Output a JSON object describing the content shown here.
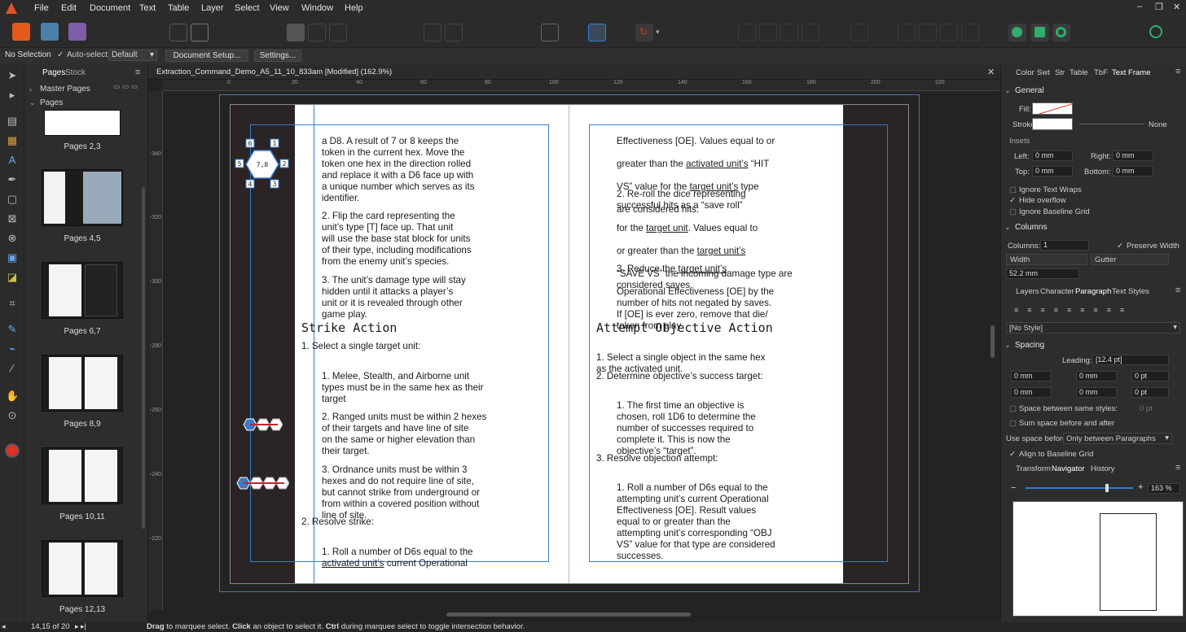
{
  "menu": [
    "File",
    "Edit",
    "Document",
    "Text",
    "Table",
    "Layer",
    "Select",
    "View",
    "Window",
    "Help"
  ],
  "context": {
    "selection": "No Selection",
    "autoselect_label": "Auto-select:",
    "autoselect_value": "Default",
    "doc_setup": "Document Setup...",
    "settings": "Settings..."
  },
  "tabs": {
    "pages": "Pages",
    "stock": "Stock"
  },
  "pages_panel": {
    "master": "Master Pages",
    "pages": "Pages",
    "thumbs": [
      "Pages 2,3",
      "Pages 4,5",
      "Pages 6,7",
      "Pages 8,9",
      "Pages 10,11",
      "Pages 12,13"
    ]
  },
  "doc_title": "Extraction_Command_Demo_A5_11_10_833am [Modified] (162.9%)",
  "ruler_h": [
    "0",
    "20",
    "40",
    "60",
    "80",
    "100",
    "120",
    "140",
    "160",
    "180",
    "200",
    "220"
  ],
  "ruler_v": [
    "-340",
    "-320",
    "-300",
    "-280",
    "-260",
    "-240",
    "-220"
  ],
  "left_page": {
    "lines1": [
      "a D8. A result of 7 or 8 keeps the",
      "token in the current hex. Move the",
      "token one hex in the direction rolled",
      "and replace it with a D6 face up with",
      "a unique number which serves as its",
      "identifier."
    ],
    "lines2": [
      "2. Flip the card representing the",
      "unit’s type [T] face up. That unit",
      "will use the base stat block for units",
      "of their type, including modifications",
      "from the enemy unit’s species."
    ],
    "lines3": [
      "3. The unit’s damage type will stay",
      "hidden until it attacks a player’s",
      "unit or it is revealed through other",
      "game play."
    ],
    "heading": "Strike Action",
    "l4": "1. Select a single target unit:",
    "lines5": [
      "1. Melee, Stealth, and Airborne unit",
      "types must be in the same hex as their",
      "target"
    ],
    "lines6": [
      "2. Ranged units must be within 2 hexes",
      "of their targets and have line of site",
      "on the same or higher elevation than",
      "their target."
    ],
    "lines7": [
      "3. Ordnance units must be within 3",
      "hexes and do not require line of site,",
      "but cannot strike from underground or",
      "from within a covered position without",
      "line of site."
    ],
    "l8": "2. Resolve strike:",
    "l9": "1. Roll a number of D6s equal to the",
    "l10a": "activated unit’s",
    "l10b": " current Operational",
    "hex_center": "7,8",
    "hex_nums": [
      "1",
      "2",
      "3",
      "4",
      "5",
      "6"
    ]
  },
  "right_page": {
    "l1": "Effectiveness [OE]. Values equal to or",
    "l2a": "greater than the ",
    "l2b": "activated unit’s",
    "l2c": " “HIT",
    "l3a": "VS” value for the ",
    "l3b": "target unit’s",
    "l3c": " type",
    "l4": "are considered hits.",
    "l5": "2. Re-roll the dice representing",
    "l6": "successful hits as a “save roll”",
    "l7a": "for the ",
    "l7b": "target unit",
    "l7c": ". Values equal to",
    "l8a": "or greater than the ",
    "l8b": "target unit’s",
    "l9": "“SAVE VS” the incoming damage type are",
    "l10": "considered saves.",
    "l11a": "3. Reduce the ",
    "l11b": "target unit’s",
    "l12": "Operational Effectiveness [OE] by the",
    "l13": "number of hits not negated by saves.",
    "l14": "If [OE] is ever zero, remove that die/",
    "l15": "token from play.",
    "heading": "Attempt Objective Action",
    "lines16": [
      "1. Select a single object in the same hex",
      "as the activated unit."
    ],
    "l17": "2. Determine objective’s success target:",
    "lines18": [
      "1. The first time an objective is",
      "chosen, roll 1D6 to determine the",
      "number of successes required to",
      "complete it. This is now the",
      "objective’s “target”."
    ],
    "l19": "3. Resolve objection attempt:",
    "lines20": [
      "1. Roll a number of D6s equal to the",
      "attempting unit’s current Operational",
      "Effectiveness [OE]. Result values",
      "equal to or greater than the",
      "attempting unit’s corresponding “OBJ",
      "VS” value for that type are considered",
      "successes."
    ]
  },
  "right_panel": {
    "tabs1": [
      "Color",
      "Swt",
      "Str",
      "Table",
      "TbF",
      "Text Frame"
    ],
    "general": "General",
    "fill": "Fill:",
    "stroke": "Stroke:",
    "stroke_none": "None",
    "insets": "Insets",
    "left": "Left:",
    "right": "Right:",
    "top": "Top:",
    "bottom": "Bottom:",
    "inset_val": "0 mm",
    "ignore_wraps": "Ignore Text Wraps",
    "hide_overflow": "Hide overflow",
    "ignore_baseline": "Ignore Baseline Grid",
    "columns": "Columns",
    "columns_label": "Columns:",
    "columns_val": "1",
    "preserve": "Preserve Width",
    "width": "Width",
    "gutter": "Gutter",
    "width_val": "52.2 mm",
    "tabs2": [
      "Layers",
      "Character",
      "Paragraph",
      "Text Styles"
    ],
    "no_style": "[No Style]",
    "spacing": "Spacing",
    "leading": "Leading:",
    "leading_val": "[12.4 pt]",
    "zero_mm": "0 mm",
    "zero_pt": "0 pt",
    "space_same": "Space between same styles:",
    "space_same_val": "0 pt",
    "sum_space": "Sum space before and after",
    "use_space": "Use space before:",
    "use_space_val": "Only between Paragraphs",
    "align_baseline": "Align to Baseline Grid",
    "tabs3": [
      "Transform",
      "Navigator",
      "History"
    ],
    "zoom": "163 %"
  },
  "status": {
    "page": "14,15 of 20",
    "hint_b1": "Drag",
    "hint_t1": " to marquee select. ",
    "hint_b2": "Click",
    "hint_t2": " an object to select it. ",
    "hint_b3": "Ctrl",
    "hint_t3": " during marquee select to toggle intersection behavior."
  },
  "colors": {
    "accent": "#2f7fd8",
    "fill_red": "#e0302a",
    "app_orange": "#e55a1c"
  }
}
